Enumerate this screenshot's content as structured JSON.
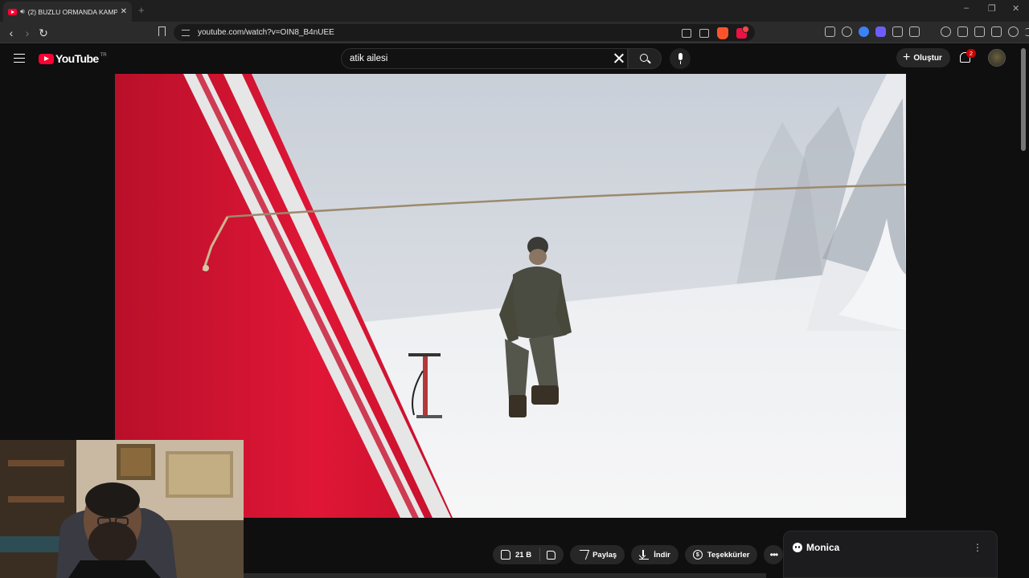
{
  "browser": {
    "tab": {
      "title": "(2) BUZLU ORMANDA KAMP",
      "close": "✕"
    },
    "new_tab": "+",
    "window_controls": {
      "minimize": "–",
      "maximize": "❐",
      "close": "✕"
    },
    "url": "youtube.com/watch?v=OIN8_B4nUEE",
    "nav": {
      "back": "‹",
      "forward": "›",
      "reload": "↻"
    }
  },
  "youtube": {
    "logo_text": "YouTube",
    "region": "TR",
    "search": {
      "query": "atik ailesi"
    },
    "create_label": "Oluştur",
    "notification_count": "2"
  },
  "video": {
    "title_hint": ""
  },
  "actions": {
    "like_count": "21 B",
    "share": "Paylaş",
    "download": "İndir",
    "thanks": "Teşekkürler",
    "more": "•••"
  },
  "monica": {
    "name": "Monica",
    "menu": "⋮"
  },
  "colors": {
    "yt_red": "#ff0033",
    "bg": "#0f0f0f",
    "pill": "#272727"
  }
}
